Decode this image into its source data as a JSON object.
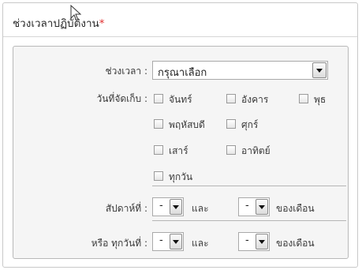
{
  "section": {
    "title": "ช่วงเวลาปฏิบัติงาน",
    "required_mark": "*"
  },
  "period": {
    "label": "ช่วงเวลา :",
    "selected": "กรุณาเลือก"
  },
  "collect_days": {
    "label": "วันที่จัดเก็บ :",
    "options": [
      "จันทร์",
      "อังคาร",
      "พุธ",
      "พฤหัสบดี",
      "ศุกร์",
      "เสาร์",
      "อาทิตย์",
      "ทุกวัน"
    ]
  },
  "week": {
    "label": "สัปดาห์ที่ :",
    "from": "-",
    "and": "และ",
    "to": "-",
    "suffix": "ของเดือน"
  },
  "day": {
    "label": "หรือ ทุกวันที่ :",
    "from": "-",
    "and": "และ",
    "to": "-",
    "suffix": "ของเดือน"
  }
}
